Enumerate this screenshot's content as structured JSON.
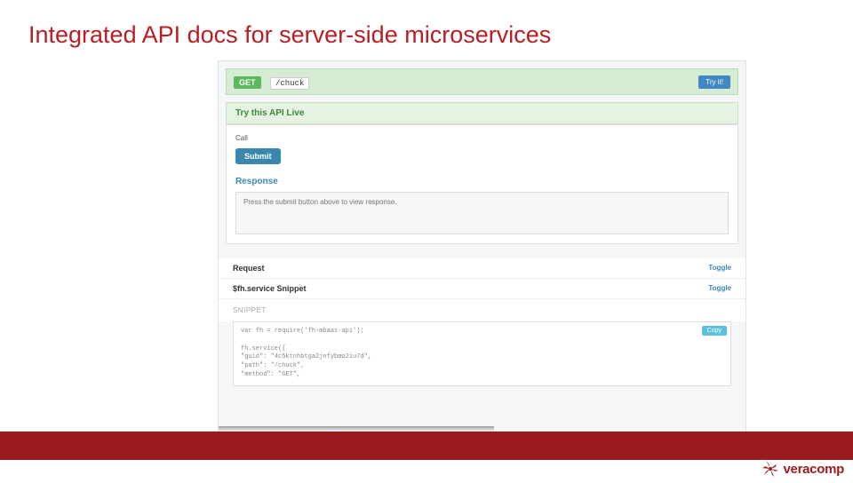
{
  "title": "Integrated API docs for server-side microservices",
  "endpoint": {
    "method": "GET",
    "path": "/chuck",
    "tryit": "Try it!"
  },
  "live": {
    "header": "Try this API Live",
    "call": "Call",
    "submit": "Submit",
    "response_label": "Response",
    "response_placeholder": "Press the submit button above to view response."
  },
  "sections": {
    "request": {
      "label": "Request",
      "toggle": "Toggle"
    },
    "snippet": {
      "label": "$fh.service Snippet",
      "toggle": "Toggle"
    }
  },
  "snippet_caption": "SNIPPET",
  "code": {
    "copy": "Copy",
    "line1": "var fh = require('fh-mbaas-api');",
    "line2": "fh.service({",
    "line3": "  \"guid\": \"4c5ktnhbtga2jnfybmo2iu7d\",",
    "line4": "  \"path\": \"/chuck\",",
    "line5": "  \"method\": \"GET\","
  },
  "brand": "veracomp"
}
